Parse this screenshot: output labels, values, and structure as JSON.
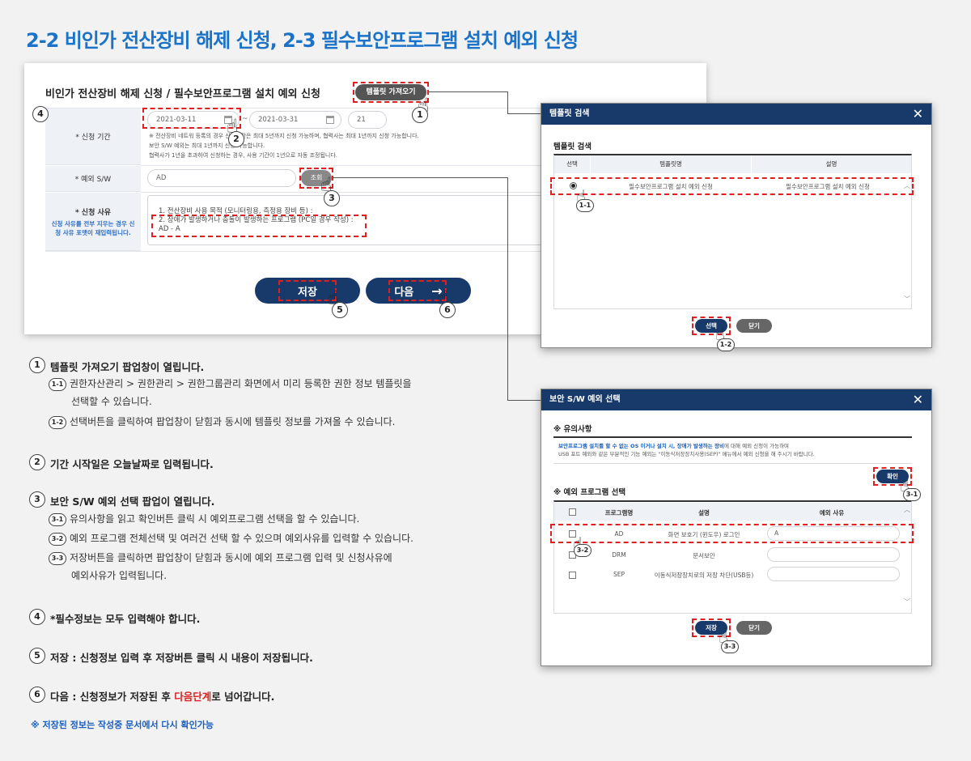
{
  "main_title": "2-2 비인가 전산장비 해제 신청, 2-3 필수보안프로그램 설치 예외 신청",
  "form": {
    "title": "비인가 전산장비 해제 신청 / 필수보안프로그램 설치 예외 신청",
    "template_button": "템플릿 가져오기",
    "period_label": "* 신청 기간",
    "date_start": "2021-03-11",
    "date_end": "2021-03-31",
    "days": "21",
    "period_note_1": "※ 전산장비 네트워 등록의 경우 신청기간은 최대 5년까지 신청 가능하며, 협력사는 최대 1년까지 신청 가능합니다.",
    "period_note_2": "보안 S/W 예외는 최대 1년까지 신청 가능합니다.",
    "period_note_3": "협력사가 1년을 초과하여 신청하는 경우, 사용 기간이 1년으로 자동 조정됩니다.",
    "sw_label": "* 예외 S/W",
    "sw_value": "AD",
    "search_button": "조회",
    "reason_label": "* 신청 사유",
    "reason_note": "신청 사유를 전부 지우는 경우 신청 사유 포맷이 재입력됩니다.",
    "reason_line_1": "1. 전산장비 사용 목적 (모니터링용, 측정용 장비 등) :",
    "reason_line_2": "2. 장애가 발생하거나 충돌이 발생하는 프로그램 (PC일 경우 작성) :",
    "reason_line_3": "AD - A",
    "save_button": "저장",
    "next_button": "다음"
  },
  "popup_template": {
    "header": "템플릿 검색",
    "section": "템플릿 검색",
    "col_select": "선택",
    "col_name": "템플릿명",
    "col_desc": "설명",
    "row_name": "필수보안프로그램 설치 예외 신청",
    "row_desc": "필수보안프로그램 설치 예외 신청",
    "select_button": "선택",
    "close_button": "닫기"
  },
  "popup_sw": {
    "header": "보안 S/W 예외 선택",
    "notice_title": "※ 유의사항",
    "notice_bold": "보안프로그램 설치를 할 수 없는 OS 이거나 설치 시, 장애가 발생하는 장비",
    "notice_rest": "에 대해 예외 신청이 가능하며",
    "notice_line_2": "USB 포트 예외와 같은 부분적인 기능 예외는 \"이동식저장장치사용(SEP)\" 메뉴에서 예외 신청을 해 주시기 바랍니다.",
    "confirm_button": "확인",
    "section": "※ 예외 프로그램 선택",
    "col_program": "프로그램명",
    "col_desc": "설명",
    "col_reason": "예외 사유",
    "rows": [
      {
        "name": "AD",
        "desc": "화면 보호기 (윈도우) 로그인",
        "reason": "A"
      },
      {
        "name": "DRM",
        "desc": "문서보안",
        "reason": ""
      },
      {
        "name": "SEP",
        "desc": "이동식저장장치로의 저장 차단(USB등)",
        "reason": ""
      }
    ],
    "save_button": "저장",
    "close_button": "닫기"
  },
  "markers": {
    "m1": "1",
    "m2": "2",
    "m3": "3",
    "m4": "4",
    "m5": "5",
    "m6": "6",
    "m1_1": "1-1",
    "m1_2": "1-2",
    "m3_1": "3-1",
    "m3_2": "3-2",
    "m3_3": "3-3"
  },
  "explanations": {
    "e1": "템플릿 가져오기 팝업창이 열립니다.",
    "e1_1a": "권한자산관리 > 권한관리 > 권한그룹관리 화면에서 미리 등록한 권한 정보 템플릿을",
    "e1_1b": "선택할 수 있습니다.",
    "e1_2": "선택버튼을 클릭하여 팝업창이 닫힘과 동시에 템플릿 정보를 가져올 수 있습니다.",
    "e2": "기간 시작일은 오늘날짜로 입력됩니다.",
    "e3": "보안 S/W 예외 선택 팝업이 열립니다.",
    "e3_1": "유의사항을 읽고 확인버튼 클릭 시 예외프로그램 선택을 할 수 있습니다.",
    "e3_2": "예외 프로그램 전체선택 및 여러건 선택 할 수 있으며 예외사유를 입력할 수 있습니다.",
    "e3_3a": "저장버튼을 클릭하면 팝업창이 닫힘과 동시에 예외 프로그램 입력 및 신청사유에",
    "e3_3b": "예외사유가 입력됩니다.",
    "e4": "*필수정보는 모두 입력해야 합니다.",
    "e5": "저장 : 신청정보 입력 후 저장버튼 클릭 시 내용이 저장됩니다.",
    "e6_a": "다음 : 신청정보가 저장된 후 ",
    "e6_red": "다음단계",
    "e6_b": "로 넘어갑니다.",
    "footnote": "※ 저장된 정보는 작성중 문서에서 다시 확인가능"
  }
}
